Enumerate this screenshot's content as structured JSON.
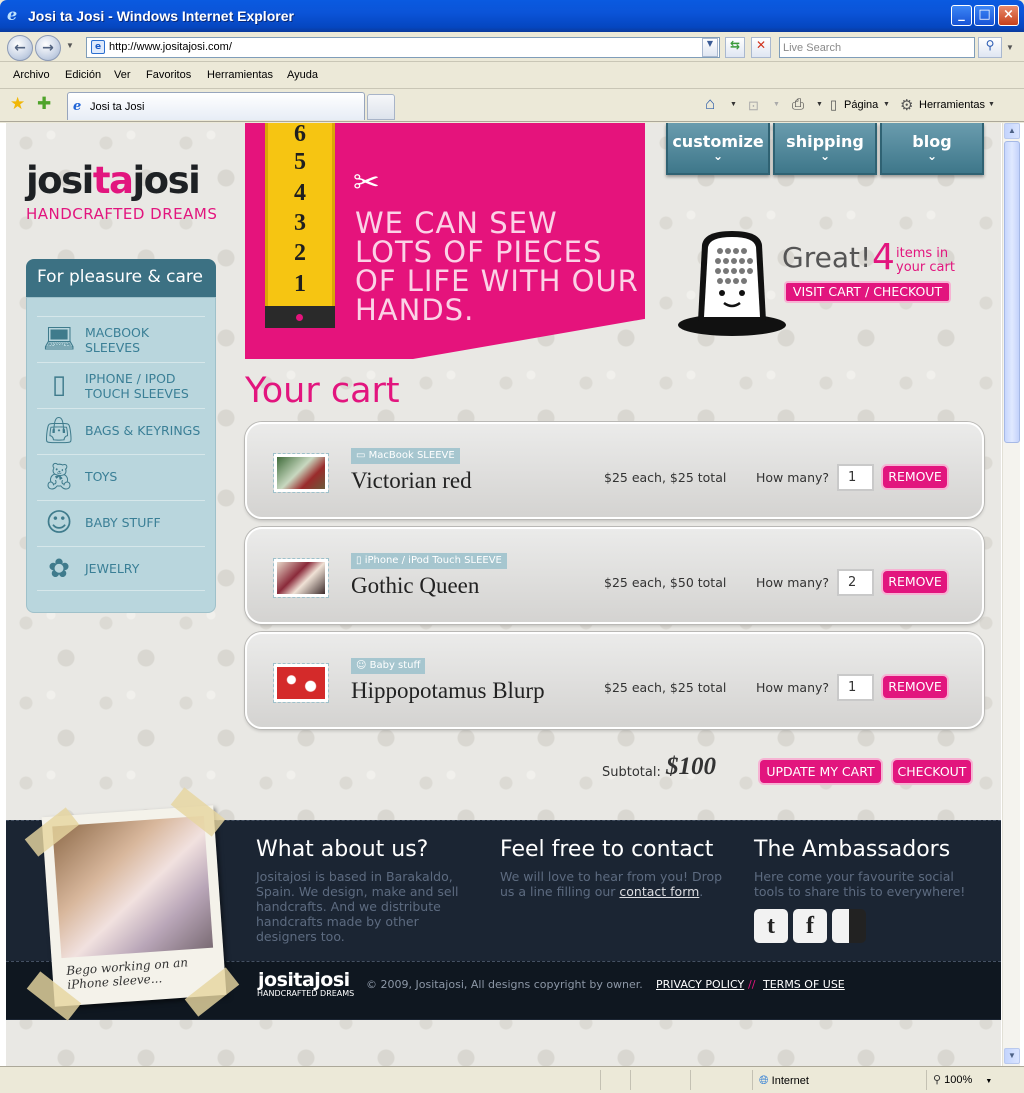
{
  "window": {
    "title": "Josi ta Josi - Windows Internet Explorer",
    "minimize": "_",
    "maximize": "□",
    "close": "×"
  },
  "address": {
    "url": "http://www.jositajosi.com/",
    "search_placeholder": "Live Search"
  },
  "menu": [
    "Archivo",
    "Edición",
    "Ver",
    "Favoritos",
    "Herramientas",
    "Ayuda"
  ],
  "tab": {
    "title": "Josi ta Josi"
  },
  "commandbar": {
    "page": "Página",
    "tools": "Herramientas"
  },
  "status": {
    "zone": "Internet",
    "zoom": "100%"
  },
  "logo": {
    "part1": "josi",
    "part2": "ta",
    "part3": "josi",
    "tagline": "HANDCRAFTED DREAMS"
  },
  "sidebar": {
    "heading": "For pleasure & care",
    "items": [
      {
        "label": "MACBOOK SLEEVES",
        "icon": "laptop-icon"
      },
      {
        "label": "IPHONE / IPOD TOUCH SLEEVES",
        "icon": "phone-icon"
      },
      {
        "label": "BAGS & KEYRINGS",
        "icon": "bag-icon"
      },
      {
        "label": "TOYS",
        "icon": "teddy-bear-icon"
      },
      {
        "label": "BABY STUFF",
        "icon": "bib-icon"
      },
      {
        "label": "JEWELRY",
        "icon": "flower-icon"
      }
    ]
  },
  "banner": {
    "text": "WE CAN SEW LOTS OF PIECES OF LIFE WITH OUR HANDS.",
    "tape_numbers": [
      "6",
      "5",
      "4",
      "3",
      "2",
      "1"
    ]
  },
  "nav": [
    {
      "label": "customize"
    },
    {
      "label": "shipping"
    },
    {
      "label": "blog"
    }
  ],
  "cart_summary": {
    "great": "Great!",
    "count": "4",
    "items_label": "items in your cart",
    "button": "VISIT CART / CHECKOUT"
  },
  "cart": {
    "title": "Your cart",
    "how_many_label": "How many?",
    "remove_label": "REMOVE",
    "items": [
      {
        "category": "MacBook SLEEVE",
        "name": "Victorian red",
        "price": "$25 each, $25 total",
        "qty": "1",
        "thumb_color": "#3f6b3a"
      },
      {
        "category": "iPhone / iPod Touch SLEEVE",
        "name": "Gothic Queen",
        "price": "$25 each, $50 total",
        "qty": "2",
        "thumb_color": "#8a2a3a"
      },
      {
        "category": "Baby stuff",
        "name": "Hippopotamus Blurp",
        "price": "$25 each, $25 total",
        "qty": "1",
        "thumb_color": "#d42a2a"
      }
    ],
    "subtotal_label": "Subtotal:",
    "subtotal_value": "$100",
    "update_button": "UPDATE MY CART",
    "checkout_button": "CHECKOUT"
  },
  "footer": {
    "about": {
      "title": "What about us?",
      "text": "Jositajosi is based in Barakaldo, Spain. We design, make and sell handcrafts. And we distribute handcrafts made by other designers too."
    },
    "contact": {
      "title": "Feel free to contact",
      "text": "We will love to hear from you! Drop us a line filling our",
      "link": "contact form",
      "end": "."
    },
    "ambassadors": {
      "title": "The Ambassadors",
      "text": "Here come your favourite social tools to share this to everywhere!",
      "icons": [
        "t",
        "f",
        "d"
      ]
    },
    "logo": "jositajosi",
    "logo_sub": "HANDCRAFTED DREAMS",
    "copyright": "© 2009, Jositajosi, All designs copyright by owner.",
    "privacy": "PRIVACY POLICY",
    "separator": "//",
    "terms": "TERMS OF USE",
    "photo_caption": "Bego working on an iPhone sleeve..."
  },
  "colors": {
    "brand_pink": "#e2157e",
    "teal": "#3c7183",
    "footer_dark": "#1b2533"
  }
}
